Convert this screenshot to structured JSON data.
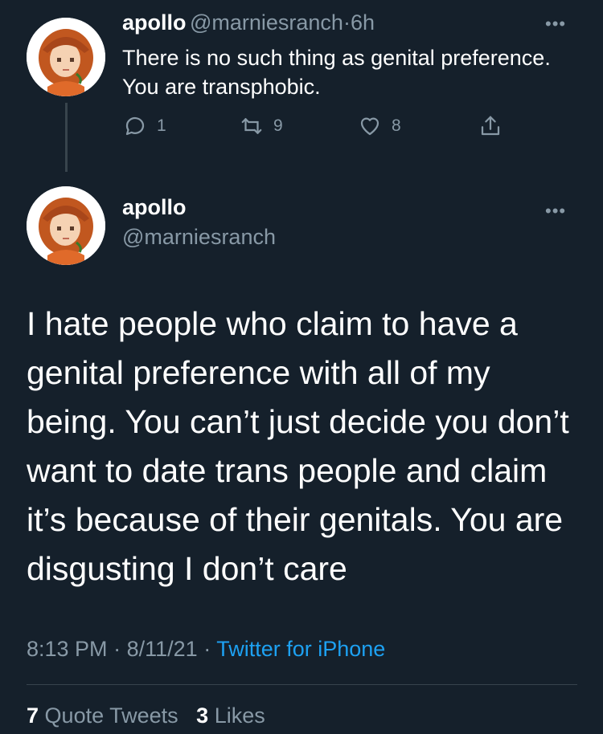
{
  "reply": {
    "name": "apollo",
    "handle": "@marniesranch",
    "sep": "·",
    "time": "6h",
    "text": "There is no such thing as genital preference. You are transphobic.",
    "more": "•••",
    "replies": "1",
    "retweets": "9",
    "likes": "8"
  },
  "main": {
    "name": "apollo",
    "handle": "@marniesranch",
    "more": "•••",
    "text": "I hate people who claim to have a genital preference with all of my being. You can’t just decide you don’t want to date trans people and claim it’s because of their genitals. You are disgusting I don’t care",
    "time": "8:13 PM",
    "sep1": "·",
    "date": "8/11/21",
    "sep2": "·",
    "source": "Twitter for iPhone"
  },
  "stats": {
    "quote_count": "7",
    "quote_label": "Quote Tweets",
    "like_count": "3",
    "like_label": "Likes"
  },
  "colors": {
    "background": "#15202b",
    "muted": "#8899a6",
    "link": "#1da1f2",
    "divider": "#38444d"
  }
}
